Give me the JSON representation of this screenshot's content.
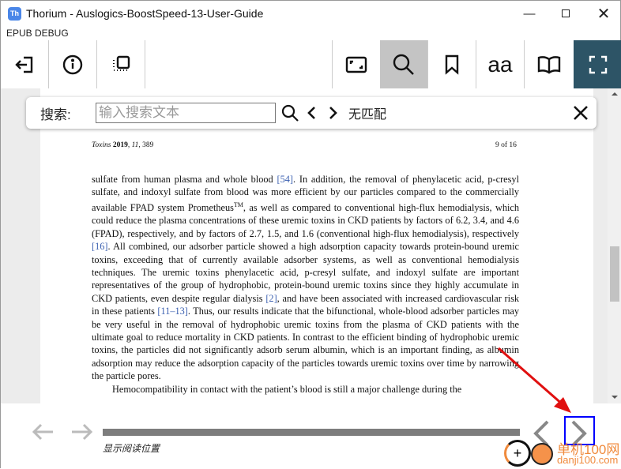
{
  "window": {
    "title": "Thorium - Auslogics-BoostSpeed-13-User-Guide",
    "app_icon": "Th"
  },
  "menu": {
    "label": "EPUB DEBUG"
  },
  "toolbar": {
    "left": [
      "back-to-library-icon",
      "info-icon",
      "toc-icon"
    ],
    "right": [
      "fit-screen-icon",
      "search-icon",
      "bookmark-icon",
      "text-settings-icon",
      "reading-mode-icon",
      "fullscreen-icon"
    ],
    "font_glyph": "aa",
    "accent": "#2d5466",
    "active_bg": "#c4c4c4"
  },
  "search": {
    "label": "搜索:",
    "placeholder": "输入搜索文本",
    "value": "",
    "status": "无匹配"
  },
  "page": {
    "header_journal": "Toxins",
    "header_year": "2019",
    "header_vol": "11",
    "header_num": ", 389",
    "page_of": "9 of 16",
    "p1": [
      {
        "t": "sulfate from human plasma and whole blood "
      },
      {
        "c": "[54]"
      },
      {
        "t": ".  In addition, the removal of phenylacetic acid, p-cresyl sulfate, and indoxyl sulfate from blood was more efficient by our particles compared to the commercially available FPAD system Prometheus"
      },
      {
        "s": "TM"
      },
      {
        "t": ", as well as compared to conventional high-flux hemodialysis, which could reduce the plasma concentrations of these uremic toxins in CKD patients by factors of 6.2, 3.4, and 4.6 (FPAD), respectively, and by factors of 2.7, 1.5, and 1.6 (conventional high-flux hemodialysis), respectively "
      },
      {
        "c": "[16]"
      },
      {
        "t": ".  All combined, our adsorber particle showed a high adsorption capacity towards protein-bound uremic toxins, exceeding that of currently available adsorber systems, as well as conventional hemodialysis techniques.  The uremic toxins phenylacetic acid, p-cresyl sulfate, and indoxyl sulfate are important representatives of the group of hydrophobic, protein-bound uremic toxins since they highly accumulate in CKD patients, even despite regular dialysis "
      },
      {
        "c": "[2]"
      },
      {
        "t": ", and have been associated with increased cardiovascular risk in these patients "
      },
      {
        "c": "[11–13]"
      },
      {
        "t": ". Thus, our results indicate that the bifunctional, whole-blood adsorber particles may be very useful in the removal of hydrophobic uremic toxins from the plasma of CKD patients with the ultimate goal to reduce mortality in CKD patients. In contrast to the efficient binding of hydrophobic uremic toxins, the particles did not significantly adsorb serum albumin, which is an important finding, as albumin adsorption may reduce the adsorption capacity of the particles towards uremic toxins over time by narrowing the particle pores."
      }
    ],
    "p2": "Hemocompatibility in contact with the patient’s blood is still a major challenge during the"
  },
  "bottom": {
    "progress_label": "显示阅读位置",
    "progress_percent": 100
  },
  "watermark": {
    "cn": "单机100网",
    "url": "danji100.com"
  }
}
